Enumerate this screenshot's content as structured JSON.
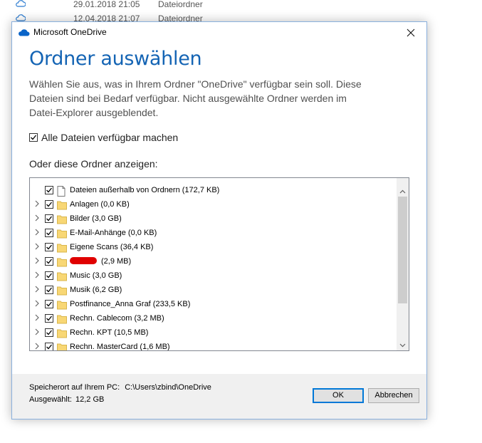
{
  "background_rows": [
    {
      "date": "29.01.2018 21:05",
      "type": "Dateiordner"
    },
    {
      "date": "12.04.2018 21:07",
      "type": "Dateiordner"
    }
  ],
  "dialog": {
    "app_title": "Microsoft OneDrive",
    "heading": "Ordner auswählen",
    "description_lines": [
      "Wählen Sie aus, was in Ihrem Ordner \"OneDrive\" verfügbar sein soll. Diese",
      "Dateien sind bei Bedarf verfügbar. Nicht ausgewählte Ordner werden im",
      "Datei-Explorer ausgeblendet."
    ],
    "all_files_label": "Alle Dateien verfügbar machen",
    "all_files_checked": true,
    "folders_heading": "Oder diese Ordner anzeigen:",
    "tree": [
      {
        "label": "Dateien außerhalb von Ordnern  (172,7 KB)",
        "icon": "file-icon",
        "expandable": false,
        "checked": true
      },
      {
        "label": "Anlagen  (0,0 KB)",
        "icon": "folder-icon",
        "expandable": true,
        "checked": true
      },
      {
        "label": "Bilder  (3,0 GB)",
        "icon": "folder-icon",
        "expandable": true,
        "checked": true
      },
      {
        "label": "E-Mail-Anhänge  (0,0 KB)",
        "icon": "folder-icon",
        "expandable": true,
        "checked": true
      },
      {
        "label": "Eigene Scans  (36,4 KB)",
        "icon": "folder-icon",
        "expandable": true,
        "checked": true
      },
      {
        "label": "(2,9 MB)",
        "icon": "folder-icon",
        "expandable": true,
        "checked": true,
        "redacted": true
      },
      {
        "label": "Music  (3,0 GB)",
        "icon": "folder-icon",
        "expandable": true,
        "checked": true
      },
      {
        "label": "Musik  (6,2 GB)",
        "icon": "folder-icon",
        "expandable": true,
        "checked": true
      },
      {
        "label": "Postfinance_Anna Graf  (233,5 KB)",
        "icon": "folder-icon",
        "expandable": true,
        "checked": true
      },
      {
        "label": "Rechn. Cablecom  (3,2 MB)",
        "icon": "folder-icon",
        "expandable": true,
        "checked": true
      },
      {
        "label": "Rechn. KPT  (10,5 MB)",
        "icon": "folder-icon",
        "expandable": true,
        "checked": true
      },
      {
        "label": "Rechn. MasterCard  (1,6 MB)",
        "icon": "folder-icon",
        "expandable": true,
        "checked": true
      }
    ],
    "footer": {
      "location_label": "Speicherort auf Ihrem PC:",
      "location_path": "C:\\Users\\zbind\\OneDrive",
      "selected_label": "Ausgewählt:",
      "selected_size": "12,2 GB",
      "ok_label": "OK",
      "cancel_label": "Abbrechen"
    }
  },
  "colors": {
    "accent": "#1464b4",
    "folder": "#f8d775",
    "redaction": "#e00000",
    "footer_bg": "#f0f0f0"
  }
}
